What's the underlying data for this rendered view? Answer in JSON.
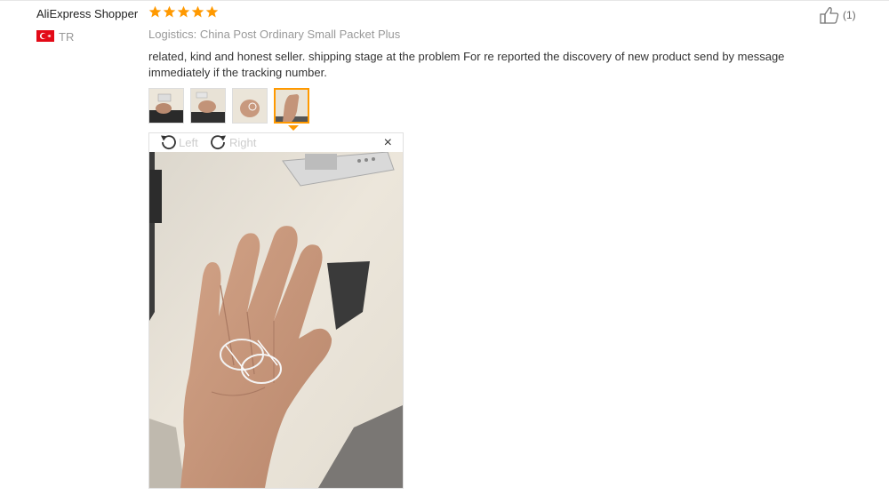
{
  "review": {
    "user_name": "AliExpress Shopper",
    "rating": 5,
    "country_code": "TR",
    "logistics_label": "Logistics:",
    "logistics_value": "China Post Ordinary Small Packet Plus",
    "text": "related, kind and honest seller. shipping stage at the problem For re reported the discovery of new product send by message immediately if the tracking number.",
    "helpful_count": "(1)"
  },
  "viewer": {
    "rotate_left_label": "Left",
    "rotate_right_label": "Right",
    "close_glyph": "×",
    "selected_photo": 4,
    "photo_count": 4
  },
  "colors": {
    "star": "#ff9900",
    "thumb_active_border": "#ff9900",
    "flag_red": "#e30a17"
  },
  "icons": [
    "star-icon",
    "turkey-flag-icon",
    "thumbs-up-icon",
    "rotate-left-icon",
    "rotate-right-icon",
    "close-icon"
  ]
}
